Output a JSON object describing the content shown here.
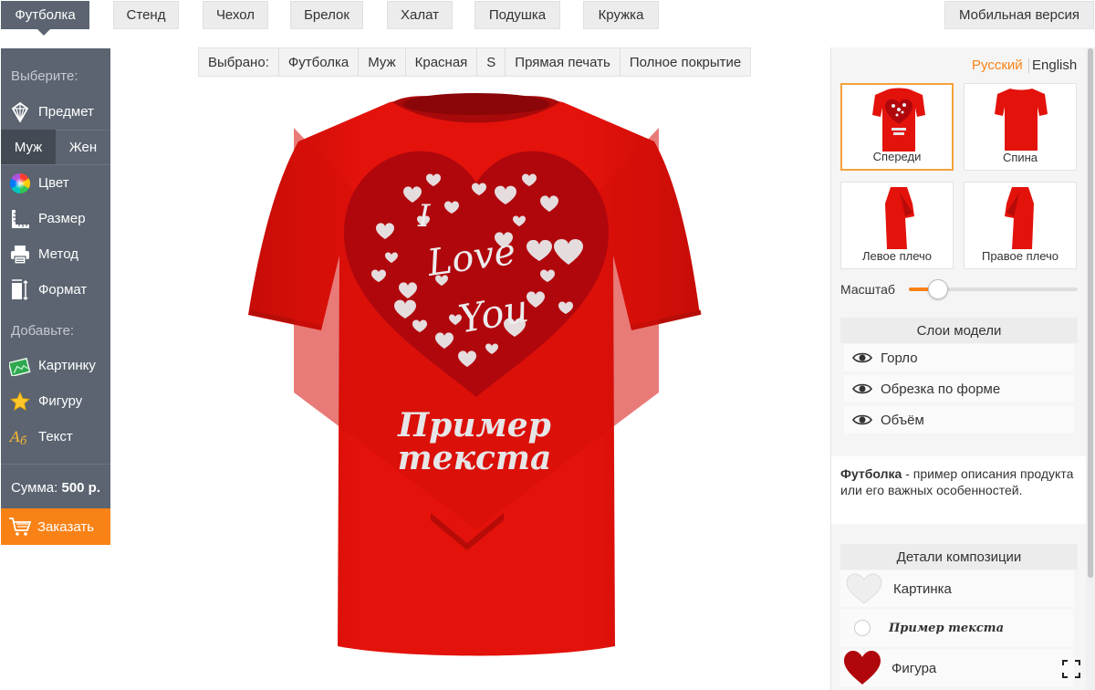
{
  "top_tabs": [
    {
      "label": "Футболка",
      "active": true
    },
    {
      "label": "Стенд"
    },
    {
      "label": "Чехол"
    },
    {
      "label": "Брелок"
    },
    {
      "label": "Халат"
    },
    {
      "label": "Подушка"
    },
    {
      "label": "Кружка"
    }
  ],
  "mobile_label": "Мобильная версия",
  "sidebar": {
    "choose_heading": "Выберите:",
    "item_subject": "Предмет",
    "gender_male": "Муж",
    "gender_female": "Жен",
    "item_color": "Цвет",
    "item_size": "Размер",
    "item_method": "Метод",
    "item_format": "Формат",
    "add_heading": "Добавьте:",
    "add_picture": "Картинку",
    "add_shape": "Фигуру",
    "add_text": "Текст",
    "sum_label": "Сумма:",
    "sum_value": "500 р.",
    "order_label": "Заказать"
  },
  "selected": {
    "label": "Выбрано:",
    "product": "Футболка",
    "gender": "Муж",
    "color": "Красная",
    "size": "S",
    "method": "Прямая печать",
    "coverage": "Полное покрытие"
  },
  "design": {
    "line1": "I",
    "line2": "Love",
    "line3": "You",
    "sample_line1": "Пример",
    "sample_line2": "текста",
    "shirt_color": "#e3120b"
  },
  "languages": {
    "ru": "Русский",
    "en": "English"
  },
  "views": [
    {
      "label": "Спереди",
      "active": true
    },
    {
      "label": "Спина"
    },
    {
      "label": "Левое плечо"
    },
    {
      "label": "Правое плечо"
    }
  ],
  "scale_label": "Масштаб",
  "scale_value": 0.12,
  "layers": {
    "title": "Слои модели",
    "items": [
      "Горло",
      "Обрезка по форме",
      "Объём"
    ]
  },
  "description": {
    "bold": "Футболка",
    "text": " - пример описания продукта или его важных особенностей."
  },
  "composition": {
    "title": "Детали композиции",
    "items": [
      "Картинка",
      "Пример текста",
      "Фигура"
    ]
  },
  "colors": {
    "accent": "#f98216",
    "sidebar": "#5b6470",
    "lang_active": "#f98216",
    "heart_dark": "#b0070d"
  }
}
